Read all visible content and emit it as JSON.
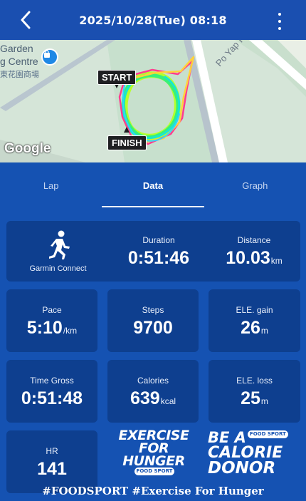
{
  "header": {
    "title": "2025/10/28(Tue) 08:18"
  },
  "map": {
    "place_line1": "Garden",
    "place_line2": "g Centre",
    "place_line3": "東花園商場",
    "road": "Po Yap Ro",
    "start_label": "START",
    "finish_label": "FINISH",
    "provider": "Google"
  },
  "tabs": [
    {
      "label": "Lap"
    },
    {
      "label": "Data"
    },
    {
      "label": "Graph"
    }
  ],
  "summary": {
    "source_label": "Garmin Connect",
    "duration": {
      "label": "Duration",
      "value": "0:51:46"
    },
    "distance": {
      "label": "Distance",
      "value": "10.03",
      "unit": "km"
    }
  },
  "metrics": {
    "pace": {
      "label": "Pace",
      "value": "5:10",
      "unit": "/km"
    },
    "steps": {
      "label": "Steps",
      "value": "9700"
    },
    "ele_gain": {
      "label": "ELE. gain",
      "value": "26",
      "unit": "m"
    },
    "time_gross": {
      "label": "Time Gross",
      "value": "0:51:48"
    },
    "calories": {
      "label": "Calories",
      "value": "639",
      "unit": "kcal"
    },
    "ele_loss": {
      "label": "ELE. loss",
      "value": "25",
      "unit": "m"
    },
    "hr": {
      "label": "HR",
      "value": "141"
    }
  },
  "promo": {
    "left_line1": "EXERCISE",
    "left_line2": "FOR",
    "left_line3": "HUNGER",
    "left_badge": "FOOD SPORT",
    "right_line1": "BE A",
    "right_badge": "FOOD SPORT",
    "right_line2": "CALORIE",
    "right_line3": "DONOR"
  },
  "hashtag": "#FOODSPORT #Exercise For Hunger",
  "colors": {
    "background": "#1552b2",
    "card": "#0e3f8f",
    "header": "#1a4fb0"
  }
}
